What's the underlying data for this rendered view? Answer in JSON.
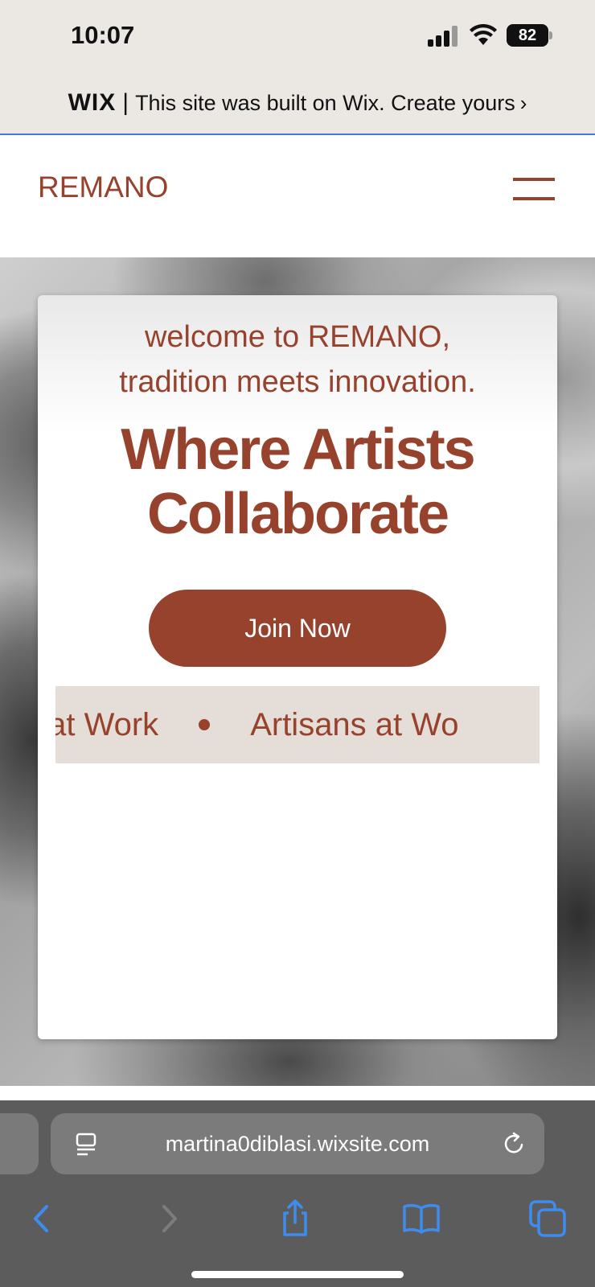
{
  "status_bar": {
    "time": "10:07",
    "battery": "82"
  },
  "wix_banner": {
    "logo": "WIX",
    "separator": "|",
    "text": "This site was built on Wix. Create yours",
    "chevron": "›"
  },
  "site": {
    "logo": "REMANO",
    "menu_icon": "hamburger-menu-icon",
    "accent_color": "#96422d"
  },
  "hero": {
    "intro_line1": "welcome to REMANO,",
    "intro_line2": "tradition meets innovation.",
    "title_line1": "Where Artists",
    "title_line2": "Collaborate",
    "cta_label": "Join Now",
    "marquee_items": [
      "s at Work",
      "Artisans at Wo"
    ]
  },
  "browser": {
    "url": "martina0diblasi.wixsite.com",
    "icons": [
      "page-menu-icon",
      "reload-icon",
      "back-icon",
      "forward-icon",
      "share-icon",
      "bookmarks-icon",
      "tabs-icon"
    ]
  }
}
